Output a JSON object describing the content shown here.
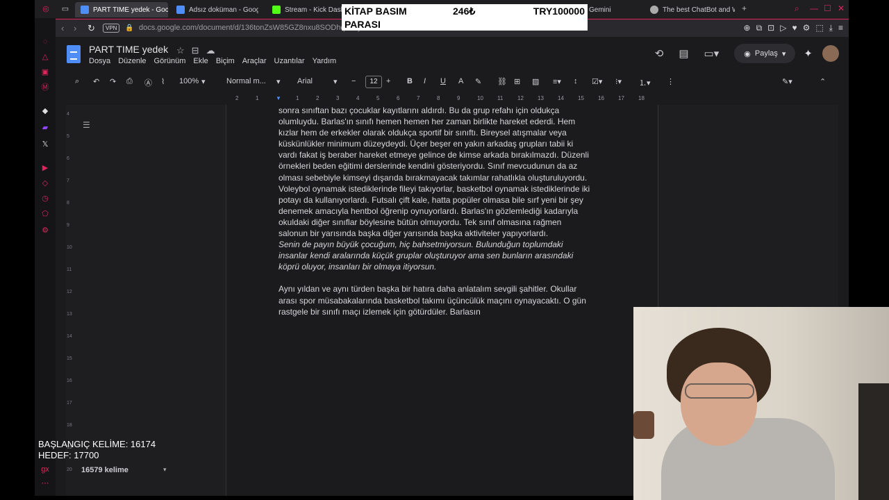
{
  "browser": {
    "tabs": [
      {
        "label": "PART TIME yedek - Goog",
        "active": true
      },
      {
        "label": "Adsız doküman - Google"
      },
      {
        "label": "Stream - Kick Dashbo"
      },
      {
        "label": "Gemini"
      },
      {
        "label": "The best ChatBot and Wr"
      }
    ],
    "new_tab": "+",
    "url": "docs.google.com/document/d/136tonZsW85GZ8nxu8SODhq29eyJ",
    "vpn": "VPN"
  },
  "overlay": {
    "item": "KİTAP BASIM",
    "amount": "246₺",
    "target": "TRY100000",
    "item_line2": "PARASI"
  },
  "docs": {
    "title": "PART TIME  yedek",
    "menu": [
      "Dosya",
      "Düzenle",
      "Görünüm",
      "Ekle",
      "Biçim",
      "Araçlar",
      "Uzantılar",
      "Yardım"
    ],
    "share_label": "Paylaş",
    "toolbar": {
      "zoom": "100%",
      "style": "Normal m...",
      "font": "Arial",
      "font_size": "12"
    },
    "ruler": [
      "2",
      "1",
      "1",
      "2",
      "3",
      "4",
      "5",
      "6",
      "7",
      "8",
      "9",
      "10",
      "11",
      "12",
      "13",
      "14",
      "15",
      "16",
      "17",
      "18"
    ],
    "vruler": [
      "4",
      "5",
      "6",
      "7",
      "8",
      "9",
      "10",
      "11",
      "12",
      "13",
      "14",
      "15",
      "16",
      "17",
      "18",
      "19",
      "20"
    ],
    "word_count": "16579 kelime"
  },
  "document_text": {
    "lines": [
      "sonra sınıftan bazı çocuklar kayıtlarını aldırdı. Bu da grup refahı için oldukça",
      "olumluydu. Barlas'ın sınıfı hemen hemen her zaman birlikte hareket ederdi. Hem",
      "kızlar hem de erkekler olarak oldukça sportif bir sınıftı. Bireysel atışmalar veya",
      "küskünlükler minimum düzeydeydi. Üçer beşer en yakın arkadaş grupları tabii ki",
      "vardı fakat iş beraber hareket etmeye gelince de kimse arkada bırakılmazdı. Düzenli",
      "örnekleri beden eğitimi derslerinde kendini gösteriyordu. Sınıf mevcudunun da az",
      "olması sebebiyle kimseyi dışarıda bırakmayacak takımlar rahatlıkla oluşturuluyordu.",
      "Voleybol oynamak istediklerinde fileyi takıyorlar, basketbol oynamak istediklerinde iki",
      "potayı da kullanıyorlardı. Futsalı çift kale, hatta popüler olmasa bile sırf yeni bir şey",
      "denemek amacıyla hentbol öğrenip oynuyorlardı. Barlas'ın gözlemlediği kadarıyla",
      "okuldaki diğer sınıflar böylesine bütün olmuyordu. Tek sınıf olmasına rağmen",
      "salonun bir yarısında başka diğer yarısında başka aktiviteler yapıyorlardı."
    ],
    "italic_lines": [
      "Senin de payın büyük çocuğum, hiç bahsetmiyorsun. Bulunduğun toplumdaki",
      "insanlar kendi aralarında küçük gruplar oluşturuyor ama sen bunların arasındaki",
      "köprü oluyor, insanları bir olmaya itiyorsun."
    ],
    "lines2": [
      "Aynı yıldan ve aynı türden başka bir hatıra daha anlatalım sevgili şahitler. Okullar",
      "arası spor müsabakalarında basketbol takımı üçüncülük maçını oynayacaktı. O gün",
      "rastgele bir sınıfı maçı izlemek için götürdüler. Barlasın"
    ]
  },
  "stream_stats": {
    "start": "BAŞLANGIÇ KELİME: 16174",
    "goal": "HEDEF: 17700"
  },
  "colors": {
    "accent": "#e0245e",
    "docs_blue": "#4f8ef7"
  }
}
